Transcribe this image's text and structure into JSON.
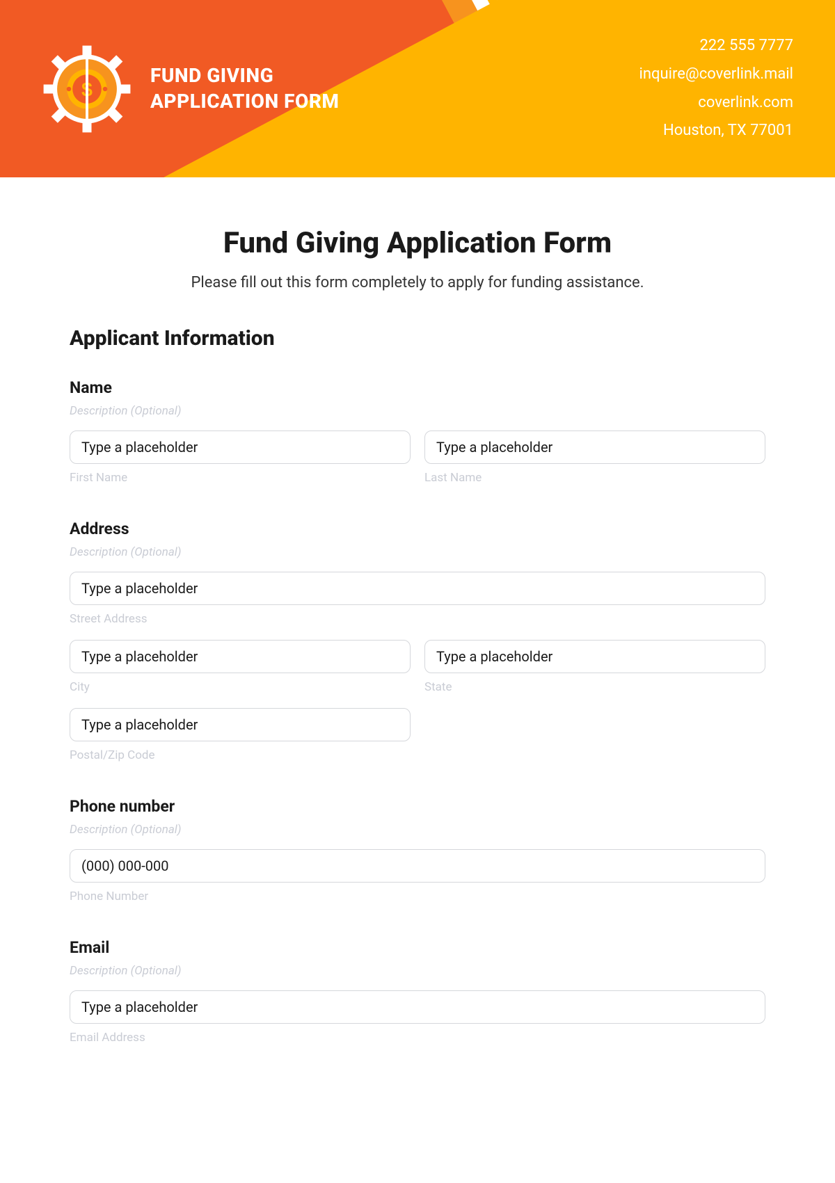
{
  "header": {
    "title_line1": "FUND GIVING",
    "title_line2": "APPLICATION FORM",
    "contact": {
      "phone": "222 555 7777",
      "email": "inquire@coverlink.mail",
      "website": "coverlink.com",
      "address": "Houston, TX 77001"
    }
  },
  "page": {
    "title": "Fund Giving Application Form",
    "subtitle": "Please fill out this form completely to apply for funding assistance."
  },
  "section1": {
    "heading": "Applicant Information"
  },
  "common": {
    "description_placeholder": "Description (Optional)",
    "input_placeholder": "Type a placeholder"
  },
  "fields": {
    "name": {
      "label": "Name",
      "first_sub": "First Name",
      "last_sub": "Last Name"
    },
    "address": {
      "label": "Address",
      "street_sub": "Street Address",
      "city_sub": "City",
      "state_sub": "State",
      "postal_sub": "Postal/Zip Code"
    },
    "phone": {
      "label": "Phone number",
      "placeholder": "(000) 000-000",
      "sub": "Phone Number"
    },
    "email": {
      "label": "Email",
      "sub": "Email Address"
    }
  }
}
